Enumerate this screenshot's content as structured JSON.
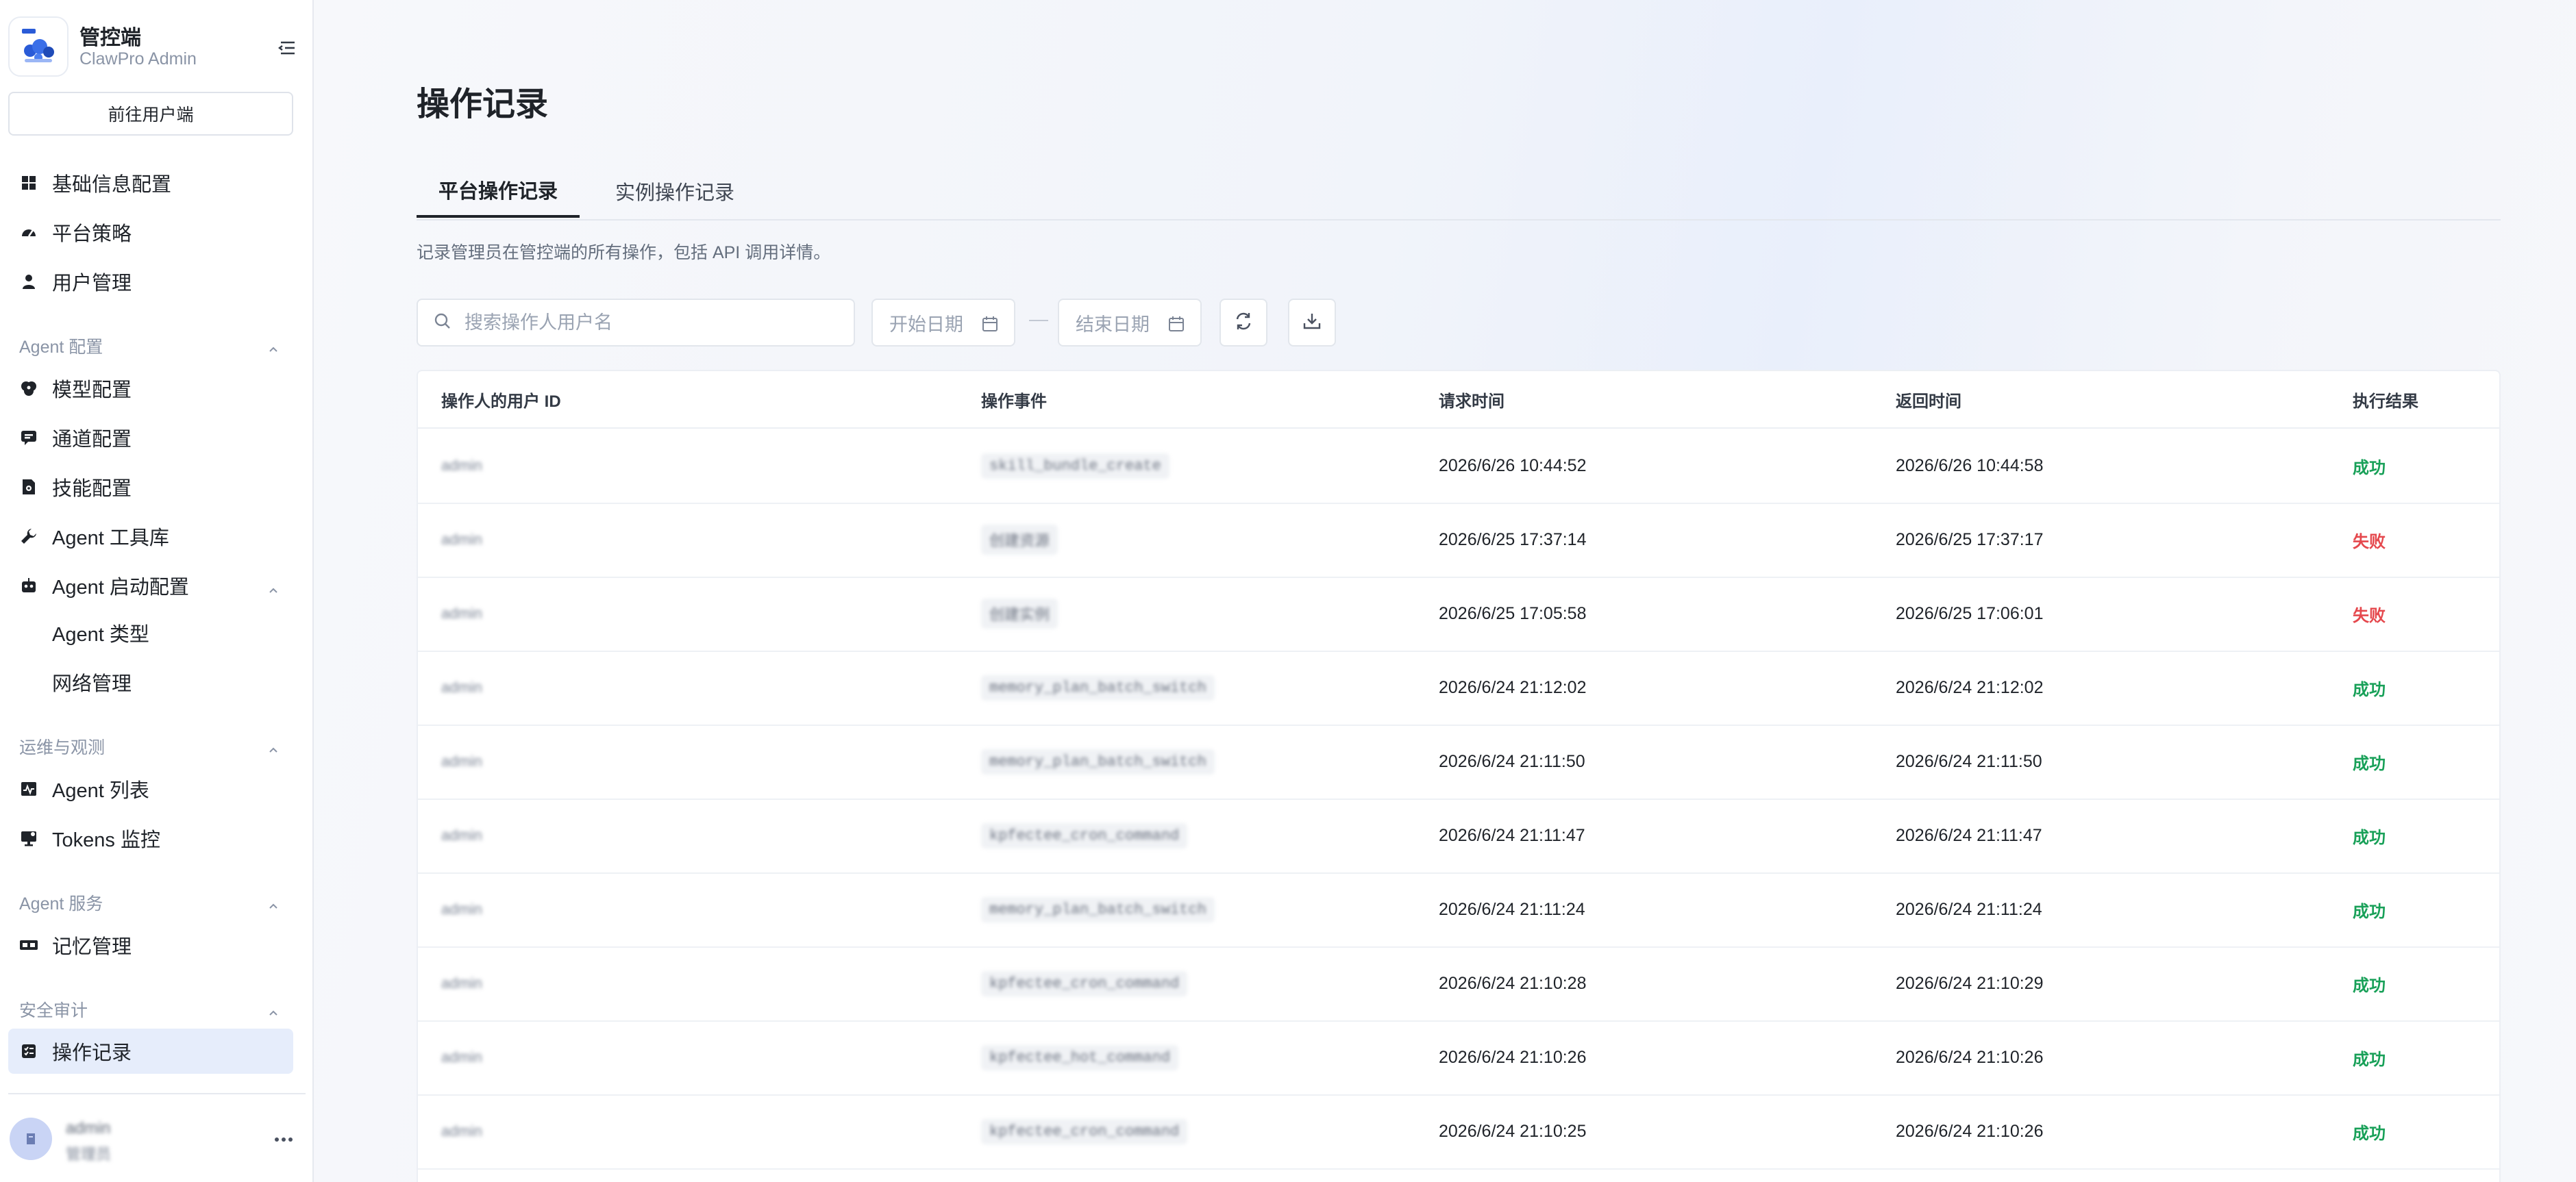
{
  "brand": {
    "name": "管控端",
    "subtitle": "ClawPro Admin"
  },
  "sidebar": {
    "user_portal_button": "前往用户端",
    "top_items": [
      {
        "label": "基础信息配置",
        "icon": "grid-icon"
      },
      {
        "label": "平台策略",
        "icon": "gauge-icon"
      },
      {
        "label": "用户管理",
        "icon": "user-icon"
      }
    ],
    "groups": {
      "agent_config": {
        "label": "Agent 配置",
        "items": [
          {
            "label": "模型配置",
            "icon": "brain-icon"
          },
          {
            "label": "通道配置",
            "icon": "message-icon"
          },
          {
            "label": "技能配置",
            "icon": "skill-icon"
          },
          {
            "label": "Agent 工具库",
            "icon": "wrench-icon"
          },
          {
            "label": "Agent 启动配置",
            "icon": "robot-icon"
          }
        ],
        "sub_items": [
          {
            "label": "Agent 类型"
          },
          {
            "label": "网络管理"
          }
        ]
      },
      "ops": {
        "label": "运维与观测",
        "items": [
          {
            "label": "Agent 列表",
            "icon": "activity-icon"
          },
          {
            "label": "Tokens 监控",
            "icon": "monitor-icon"
          }
        ]
      },
      "agent_service": {
        "label": "Agent 服务",
        "items": [
          {
            "label": "记忆管理",
            "icon": "memory-icon"
          }
        ]
      },
      "security": {
        "label": "安全审计",
        "items": [
          {
            "label": "操作记录",
            "icon": "log-icon"
          }
        ]
      }
    },
    "footer": {
      "name": "admin",
      "role": "管理员"
    }
  },
  "main": {
    "title": "操作记录",
    "tabs": [
      {
        "label": "平台操作记录",
        "active": true
      },
      {
        "label": "实例操作记录",
        "active": false
      }
    ],
    "description": "记录管理员在管控端的所有操作，包括 API 调用详情。",
    "search": {
      "placeholder": "搜索操作人用户名",
      "value": ""
    },
    "start_date": {
      "placeholder": "开始日期"
    },
    "end_date": {
      "placeholder": "结束日期"
    },
    "table": {
      "columns": [
        "操作人的用户 ID",
        "操作事件",
        "请求时间",
        "返回时间",
        "执行结果"
      ],
      "rows": [
        {
          "user": "admin",
          "event": "skill_bundle_create",
          "request_time": "2026/6/26 10:44:52",
          "response_time": "2026/6/26 10:44:58",
          "result": "成功",
          "status": "ok"
        },
        {
          "user": "admin",
          "event": "创建资源",
          "request_time": "2026/6/25 17:37:14",
          "response_time": "2026/6/25 17:37:17",
          "result": "失败",
          "status": "fail"
        },
        {
          "user": "admin",
          "event": "创建实例",
          "request_time": "2026/6/25 17:05:58",
          "response_time": "2026/6/25 17:06:01",
          "result": "失败",
          "status": "fail"
        },
        {
          "user": "admin",
          "event": "memory_plan_batch_switch",
          "request_time": "2026/6/24 21:12:02",
          "response_time": "2026/6/24 21:12:02",
          "result": "成功",
          "status": "ok"
        },
        {
          "user": "admin",
          "event": "memory_plan_batch_switch",
          "request_time": "2026/6/24 21:11:50",
          "response_time": "2026/6/24 21:11:50",
          "result": "成功",
          "status": "ok"
        },
        {
          "user": "admin",
          "event": "kpfectee_cron_command",
          "request_time": "2026/6/24 21:11:47",
          "response_time": "2026/6/24 21:11:47",
          "result": "成功",
          "status": "ok"
        },
        {
          "user": "admin",
          "event": "memory_plan_batch_switch",
          "request_time": "2026/6/24 21:11:24",
          "response_time": "2026/6/24 21:11:24",
          "result": "成功",
          "status": "ok"
        },
        {
          "user": "admin",
          "event": "kpfectee_cron_command",
          "request_time": "2026/6/24 21:10:28",
          "response_time": "2026/6/24 21:10:29",
          "result": "成功",
          "status": "ok"
        },
        {
          "user": "admin",
          "event": "kpfectee_hot_command",
          "request_time": "2026/6/24 21:10:26",
          "response_time": "2026/6/24 21:10:26",
          "result": "成功",
          "status": "ok"
        },
        {
          "user": "admin",
          "event": "kpfectee_cron_command",
          "request_time": "2026/6/24 21:10:25",
          "response_time": "2026/6/24 21:10:26",
          "result": "成功",
          "status": "ok"
        }
      ]
    }
  },
  "colors": {
    "accent": "#1f2329",
    "success": "#18a058",
    "danger": "#e5484d",
    "active_nav_bg": "#e6edfb"
  }
}
